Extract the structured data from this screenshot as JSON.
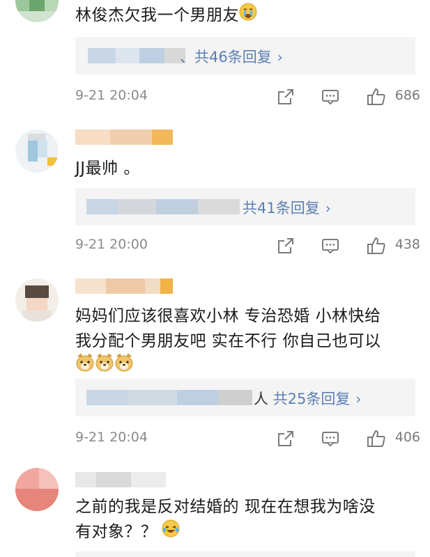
{
  "comments": [
    {
      "text_lines": [
        "林俊杰欠我一个男朋友"
      ],
      "emoji": "crying-face",
      "reply_label": "、共46条回复",
      "reply_prefix": "",
      "time": "9-21 20:04",
      "likes": "686"
    },
    {
      "text_lines": [
        "JJ最帅 。"
      ],
      "emoji": "",
      "reply_label": "共41条回复",
      "reply_prefix": "",
      "time": "9-21 20:00",
      "likes": "438"
    },
    {
      "text_lines": [
        "妈妈们应该很喜欢小林 专治恐婚 小林快给",
        "我分配个男朋友吧 实在不行 你自己也可以"
      ],
      "emoji": "doge x3",
      "reply_label": "共25条回复",
      "reply_prefix": "人",
      "time": "9-21 20:04",
      "likes": "406"
    },
    {
      "text_lines": [
        "之前的我是反对结婚的 现在在想我为啥没",
        "有对象？？"
      ],
      "emoji": "laughing-crying-face",
      "reply_label": "",
      "reply_prefix": "",
      "time": "",
      "likes": ""
    }
  ],
  "icons": {
    "repost": "share-box-icon",
    "comment": "comment-bubble-icon",
    "like": "thumbs-up-icon"
  },
  "colors": {
    "link": "#5b7fb3",
    "meta": "#8a8a8a",
    "reply_bg": "#f4f4f4"
  }
}
